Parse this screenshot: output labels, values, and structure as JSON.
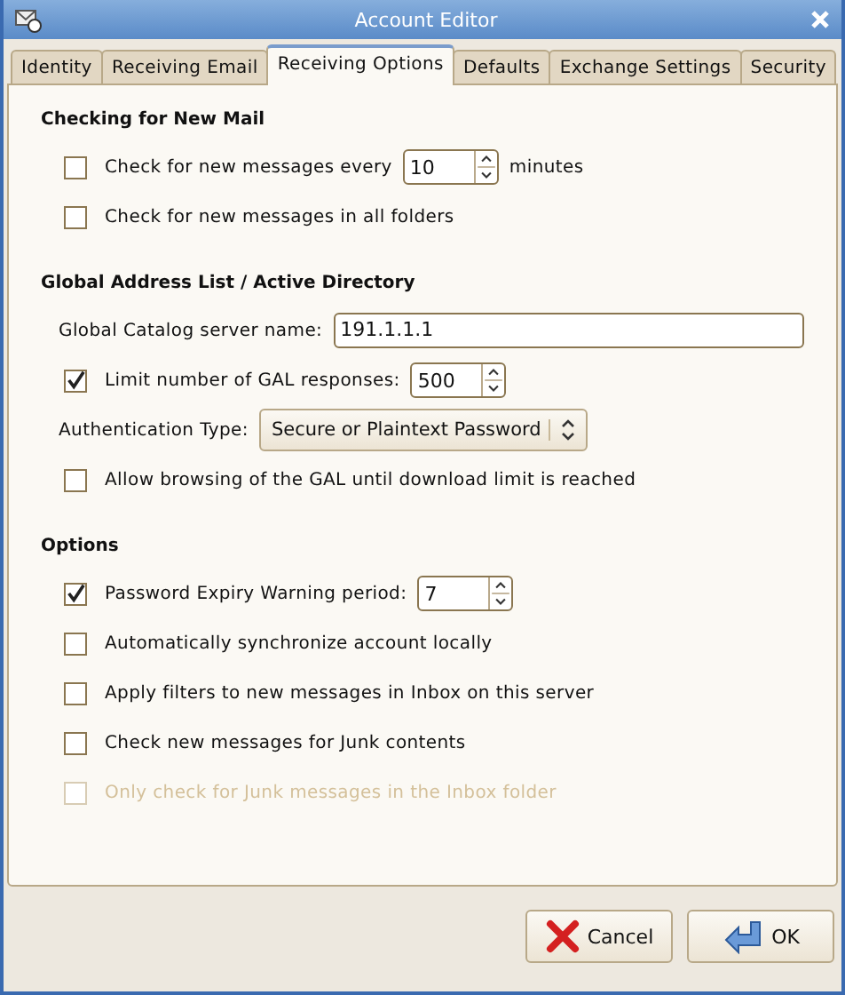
{
  "window": {
    "title": "Account Editor"
  },
  "tabs": [
    {
      "label": "Identity",
      "selected": false
    },
    {
      "label": "Receiving Email",
      "selected": false
    },
    {
      "label": "Receiving Options",
      "selected": true
    },
    {
      "label": "Defaults",
      "selected": false
    },
    {
      "label": "Exchange Settings",
      "selected": false
    },
    {
      "label": "Security",
      "selected": false
    }
  ],
  "sections": [
    {
      "title": "Checking for New Mail",
      "rows": [
        {
          "kind": "check_spin",
          "label": "Check for new messages every",
          "checked": false,
          "disabled": false,
          "value": "10",
          "suffix": "minutes"
        },
        {
          "kind": "check",
          "label": "Check for new messages in all folders",
          "checked": false,
          "disabled": false
        }
      ]
    },
    {
      "title": "Global Address List / Active Directory",
      "rows": [
        {
          "kind": "text",
          "label": "Global Catalog server name:",
          "value": "191.1.1.1"
        },
        {
          "kind": "check_spin",
          "label": "Limit number of GAL responses:",
          "checked": true,
          "disabled": false,
          "value": "500"
        },
        {
          "kind": "select",
          "label": "Authentication Type:",
          "value": "Secure or Plaintext Password"
        },
        {
          "kind": "check",
          "label": "Allow browsing of the GAL until download limit is reached",
          "checked": false,
          "disabled": false
        }
      ]
    },
    {
      "title": "Options",
      "rows": [
        {
          "kind": "check_spin",
          "label": "Password Expiry Warning period:",
          "checked": true,
          "disabled": false,
          "value": "7"
        },
        {
          "kind": "check",
          "label": "Automatically synchronize account locally",
          "checked": false,
          "disabled": false
        },
        {
          "kind": "check",
          "label": "Apply filters to new messages in Inbox on this server",
          "checked": false,
          "disabled": false
        },
        {
          "kind": "check",
          "label": "Check new messages for Junk contents",
          "checked": false,
          "disabled": false
        },
        {
          "kind": "check",
          "label": "Only check for Junk messages in the Inbox folder",
          "checked": false,
          "disabled": true
        }
      ]
    }
  ],
  "buttons": [
    {
      "kind": "cancel",
      "label": "Cancel"
    },
    {
      "kind": "ok",
      "label": "OK"
    }
  ]
}
